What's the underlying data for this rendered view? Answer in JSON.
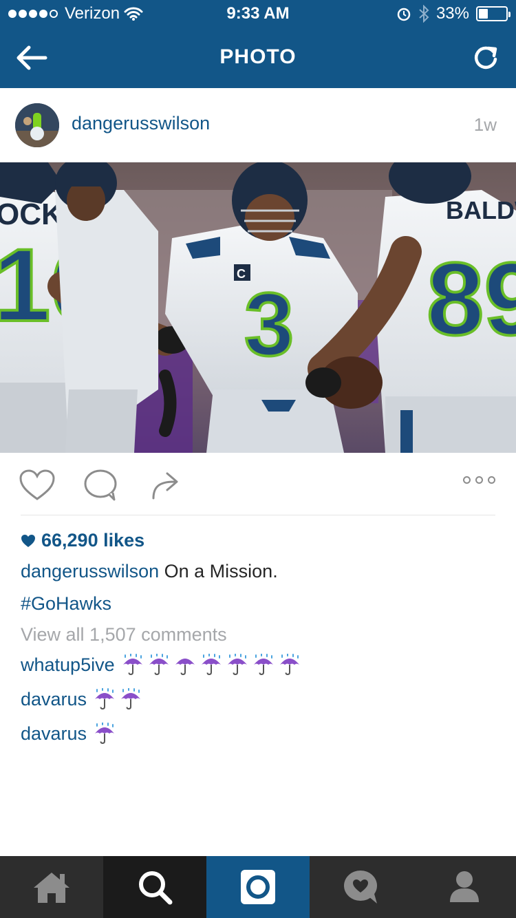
{
  "status_bar": {
    "carrier": "Verizon",
    "time": "9:33 AM",
    "battery_percent": "33%",
    "battery_level": 0.33,
    "signal_bars_filled": 4,
    "signal_bars_total": 5,
    "icons": [
      "wifi-icon",
      "alarm-icon",
      "bluetooth-icon",
      "battery-icon"
    ]
  },
  "nav": {
    "title": "PHOTO",
    "back_icon": "arrow-left-icon",
    "refresh_icon": "refresh-icon"
  },
  "post": {
    "username": "dangerusswilson",
    "time_ago": "1w",
    "likes": "66,290 likes",
    "caption_user": "dangerusswilson",
    "caption_text": "On a Mission.",
    "hashtag": "#GoHawks",
    "view_all": "View all 1,507 comments"
  },
  "comments": [
    {
      "user": "whatup5ive",
      "emoji": [
        "umbrella-rain",
        "umbrella-rain",
        "umbrella-closed",
        "umbrella-rain",
        "umbrella-rain",
        "umbrella-rain",
        "umbrella-rain"
      ]
    },
    {
      "user": "davarus",
      "emoji": [
        "umbrella-rain",
        "umbrella-rain"
      ]
    },
    {
      "user": "davarus",
      "emoji": [
        "umbrella-rain"
      ]
    }
  ],
  "tabbar": {
    "items": [
      "home-icon",
      "search-icon",
      "camera-icon",
      "activity-icon",
      "profile-icon"
    ],
    "active_index": 2
  },
  "colors": {
    "brand_blue": "#125688",
    "tab_dark": "#2d2d2d",
    "muted_text": "#a5a7aa",
    "emoji_purple": "#8a4fc9"
  }
}
